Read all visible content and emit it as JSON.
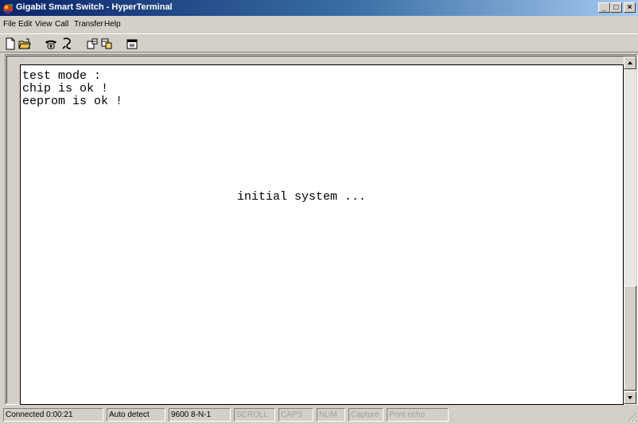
{
  "window": {
    "title": "Gigabit Smart Switch - HyperTerminal",
    "controls": {
      "minimize": "_",
      "maximize": "□",
      "close": "×"
    }
  },
  "menu": {
    "items": [
      {
        "label": "File"
      },
      {
        "label": "Edit"
      },
      {
        "label": "View"
      },
      {
        "label": "Call"
      },
      {
        "label": "Transfer"
      },
      {
        "label": "Help"
      }
    ]
  },
  "toolbar": {
    "buttons": [
      {
        "icon": "new-document-icon"
      },
      {
        "icon": "open-folder-icon"
      },
      {
        "icon": "phone-connect-icon"
      },
      {
        "icon": "disconnect-icon"
      },
      {
        "icon": "send-icon"
      },
      {
        "icon": "receive-icon"
      },
      {
        "icon": "properties-icon"
      }
    ]
  },
  "terminal": {
    "lines": [
      {
        "text": "test mode :"
      },
      {
        "text": "chip is ok !"
      },
      {
        "text": "eeprom is ok !"
      },
      {
        "text": "initial system ..."
      }
    ]
  },
  "status": {
    "connected": "Connected 0:00:21",
    "detect": "Auto detect",
    "settings": "9600 8-N-1",
    "scroll": "SCROLL",
    "caps": "CAPS",
    "num": "NUM",
    "capture": "Capture",
    "print_echo": "Print echo"
  }
}
